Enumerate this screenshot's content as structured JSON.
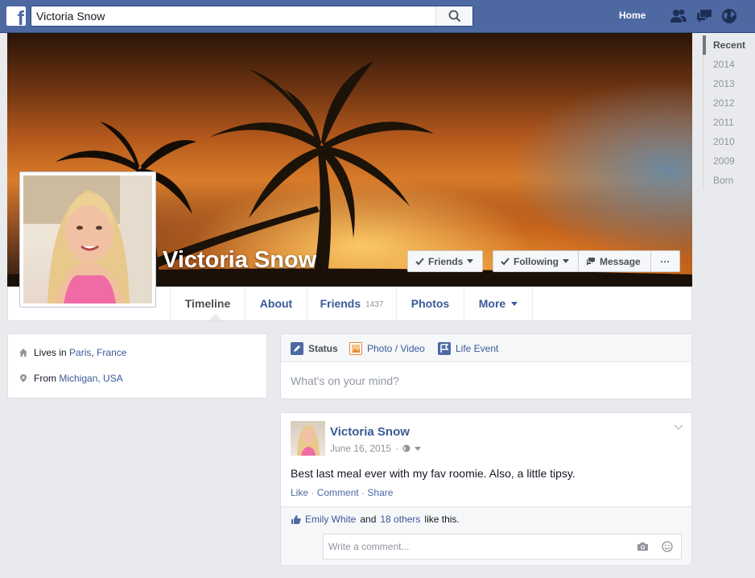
{
  "topbar": {
    "logo_letter": "f",
    "search_value": "Victoria Snow",
    "home_label": "Home",
    "icons": [
      "friend-requests-icon",
      "messages-icon",
      "notifications-globe-icon"
    ],
    "bar_color": "#4e69a2"
  },
  "profile": {
    "name": "Victoria Snow",
    "buttons": {
      "friends": "Friends",
      "following": "Following",
      "message": "Message",
      "more": "···"
    }
  },
  "tabs": [
    {
      "label": "Timeline",
      "count": ""
    },
    {
      "label": "About",
      "count": ""
    },
    {
      "label": "Friends",
      "count": "1437"
    },
    {
      "label": "Photos",
      "count": ""
    },
    {
      "label": "More",
      "count": ""
    }
  ],
  "intro": {
    "lives_prefix": "Lives in",
    "lives_city": "Paris",
    "lives_sep": ",",
    "lives_country": "France",
    "from_prefix": "From",
    "from_place": "Michigan, USA"
  },
  "composer": {
    "status": "Status",
    "photo_video": "Photo / Video",
    "life_event": "Life Event",
    "placeholder": "What's on your mind?"
  },
  "post": {
    "author": "Victoria Snow",
    "date": "June 16, 2015",
    "sep": "·",
    "text": "Best last meal ever with my fav roomie. Also, a little tipsy.",
    "actions": {
      "like": "Like",
      "comment": "Comment",
      "share": "Share",
      "dot": "·"
    },
    "likes": {
      "name": "Emily White",
      "and": "and",
      "others": "18 others",
      "suffix": "like this."
    },
    "comment_placeholder": "Write a comment..."
  },
  "timeline_nav": [
    "Recent",
    "2014",
    "2013",
    "2012",
    "2011",
    "2010",
    "2009",
    "Born"
  ],
  "colors": {
    "link": "#3b5998",
    "background": "#e9eaed",
    "accent": "#4e69a2"
  }
}
